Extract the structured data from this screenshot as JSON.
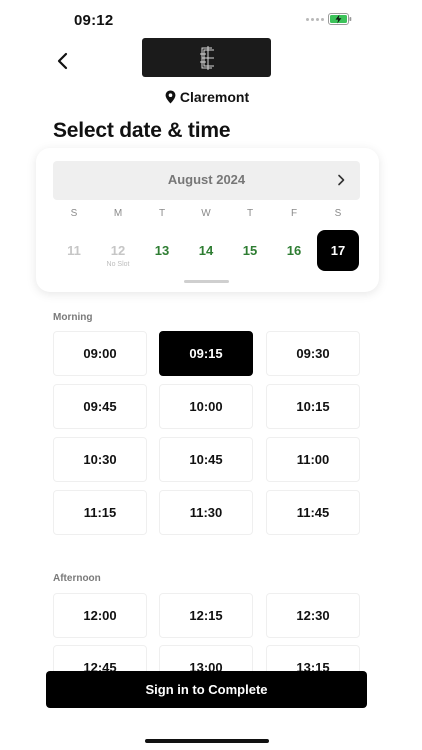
{
  "status_bar": {
    "time": "09:12",
    "battery_icon": "battery-charging-icon",
    "battery_color": "#3cc35a"
  },
  "header": {
    "back_icon": "chevron-left-icon",
    "logo_icon": "brand-monogram-logo"
  },
  "location": {
    "icon": "map-pin-icon",
    "name": "Claremont"
  },
  "title": "Select date & time",
  "calendar": {
    "month": "August 2024",
    "next_icon": "chevron-right-icon",
    "weekdays": [
      "S",
      "M",
      "T",
      "W",
      "T",
      "F",
      "S"
    ],
    "days": [
      {
        "number": "11",
        "state": "disabled",
        "note": ""
      },
      {
        "number": "12",
        "state": "disabled",
        "note": "No Slot"
      },
      {
        "number": "13",
        "state": "available",
        "note": ""
      },
      {
        "number": "14",
        "state": "available",
        "note": ""
      },
      {
        "number": "15",
        "state": "available",
        "note": ""
      },
      {
        "number": "16",
        "state": "available",
        "note": ""
      },
      {
        "number": "17",
        "state": "selected",
        "note": ""
      }
    ],
    "available_color": "#2e7d32",
    "selected_color": "#000000"
  },
  "sections": [
    {
      "label": "Morning",
      "slots": [
        "09:00",
        "09:15",
        "09:30",
        "09:45",
        "10:00",
        "10:15",
        "10:30",
        "10:45",
        "11:00",
        "11:15",
        "11:30",
        "11:45"
      ],
      "selected": "09:15"
    },
    {
      "label": "Afternoon",
      "slots": [
        "12:00",
        "12:15",
        "12:30",
        "12:45",
        "13:00",
        "13:15"
      ],
      "selected": ""
    }
  ],
  "cta": {
    "label": "Sign in to Complete"
  }
}
